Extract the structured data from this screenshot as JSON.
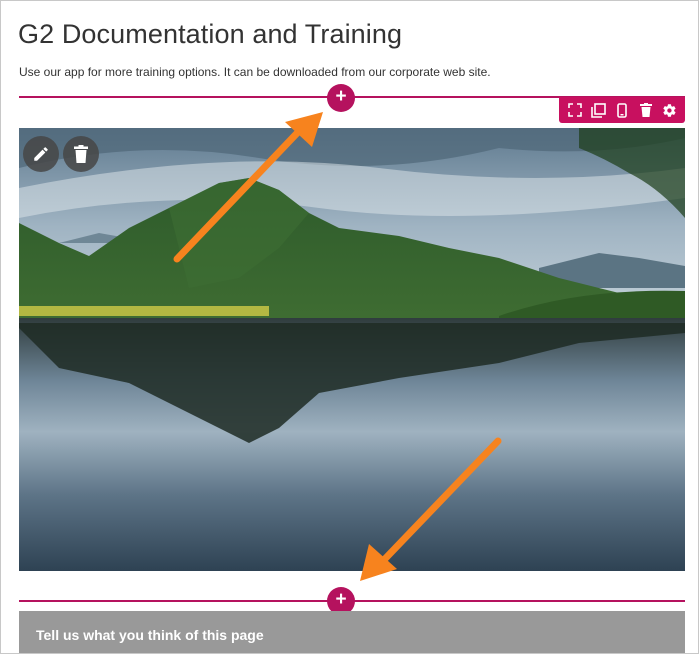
{
  "page": {
    "title": "G2 Documentation and Training",
    "subtitle": "Use our app for more training options. It can be downloaded from our corporate web site."
  },
  "add_section_label": "+",
  "toolbar": {
    "icons": [
      "expand-icon",
      "duplicate-icon",
      "mobile-icon",
      "delete-icon",
      "settings-icon"
    ],
    "color": "#c8105f"
  },
  "image_block": {
    "image_description_icon": "landscape-image",
    "edit_icon": "pencil-icon",
    "delete_icon": "trash-icon"
  },
  "feedback": {
    "label": "Tell us what you think of this page"
  },
  "colors": {
    "accent": "#b5125e",
    "arrow": "#f7831e",
    "feedback_bg": "#999999"
  }
}
